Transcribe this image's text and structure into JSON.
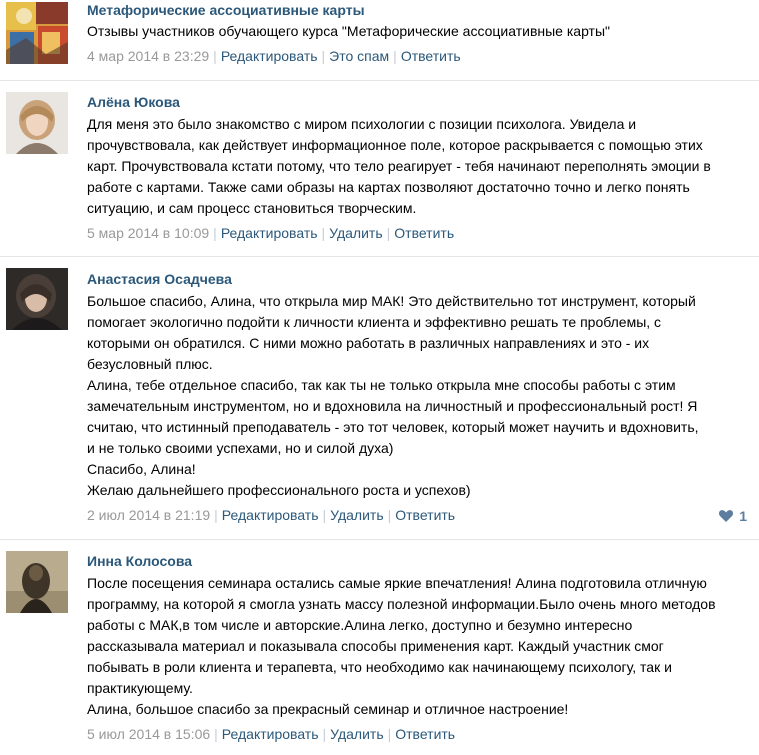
{
  "posts": [
    {
      "author": "Метафорические ассоциативные карты",
      "avatar_icon": "painting-avatar-icon",
      "lines": [
        "Отзывы участников обучающего курса \"Метафорические ассоциативные карты\""
      ],
      "date": "4 мар 2014 в 23:29",
      "actions": [
        "Редактировать",
        "Это спам",
        "Ответить"
      ]
    },
    {
      "author": "Алёна Юкова",
      "avatar_icon": "woman-portrait-avatar-icon",
      "lines": [
        "Для меня это было знакомство с миром психологии с позиции психолога. Увидела и",
        "прочувствовала, как действует информационное поле, которое раскрывается с помощью этих",
        "карт. Прочувствовала кстати потому, что тело реагирует - тебя начинают переполнять эмоции в",
        "работе с картами. Также сами образы на картах позволяют достаточно точно и легко понять",
        "ситуацию, и сам процесс становиться творческим."
      ],
      "date": "5 мар 2014 в 10:09",
      "actions": [
        "Редактировать",
        "Удалить",
        "Ответить"
      ]
    },
    {
      "author": "Анастасия Осадчева",
      "avatar_icon": "woman-dark-portrait-avatar-icon",
      "lines": [
        "Большое спасибо, Алина, что открыла мир МАК! Это действительно тот инструмент, который",
        "помогает экологично подойти к личности клиента и эффективно решать те проблемы, с",
        "которыми он обратился. С ними можно работать в различных направлениях и это - их",
        "безусловный плюс.",
        "Алина, тебе отдельное спасибо, так как ты не только открыла мне способы работы с этим",
        "замечательным инструментом, но и вдохновила на личностный и профессиональный рост! Я",
        "считаю, что истинный преподаватель - это тот человек, который может научить и вдохновить,",
        "и не только своими успехами, но и силой духа)",
        "Спасибо, Алина!",
        "Желаю дальнейшего профессионального роста и успехов)"
      ],
      "date": "2 июл 2014 в 21:19",
      "actions": [
        "Редактировать",
        "Удалить",
        "Ответить"
      ],
      "likes": "1"
    },
    {
      "author": "Инна Колосова",
      "avatar_icon": "sepia-portrait-avatar-icon",
      "lines": [
        "После посещения семинара остались самые яркие впечатления! Алина подготовила отличную",
        "программу, на которой я смогла узнать массу полезной информации.Было очень много методов",
        "работы с МАК,в том числе и авторские.Алина легко, доступно и безумно интересно",
        "рассказывала материал и показывала способы применения карт. Каждый участник смог",
        "побывать в роли клиента и терапевта, что необходимо как начинающему психологу, так и",
        "практикующему.",
        "Алина, большое спасибо за прекрасный семинар и отличное настроение!"
      ],
      "date": "5 июл 2014 в 15:06",
      "actions": [
        "Редактировать",
        "Удалить",
        "Ответить"
      ]
    }
  ],
  "colors": {
    "link": "#2b587a",
    "meta": "#999999",
    "separator": "#c5cdd6",
    "divider": "#e4e6e9",
    "like": "#5c7d9e"
  }
}
